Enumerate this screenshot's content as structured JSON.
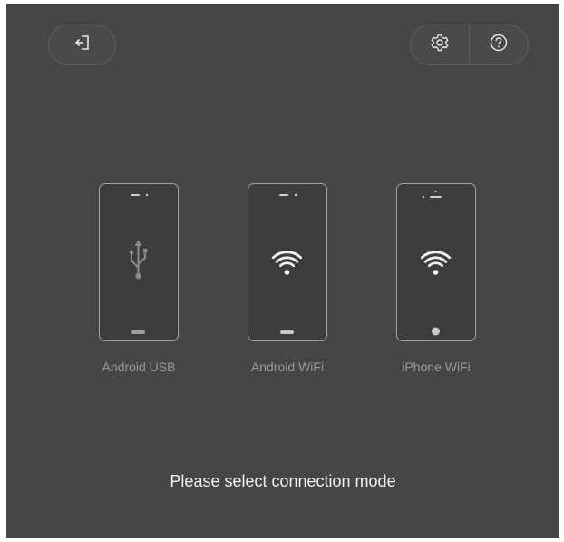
{
  "toolbar": {
    "exit_icon": "exit-icon",
    "settings_icon": "gear-icon",
    "help_icon": "help-icon"
  },
  "modes": [
    {
      "label": "Android USB",
      "icon": "usb-icon"
    },
    {
      "label": "Android WiFi",
      "icon": "wifi-icon"
    },
    {
      "label": "iPhone WiFi",
      "icon": "wifi-icon"
    }
  ],
  "prompt": "Please select connection mode",
  "colors": {
    "background": "#464647",
    "outline": "#a4a4a6",
    "label": "#9a9a9c",
    "prompt": "#f2f2f2"
  }
}
